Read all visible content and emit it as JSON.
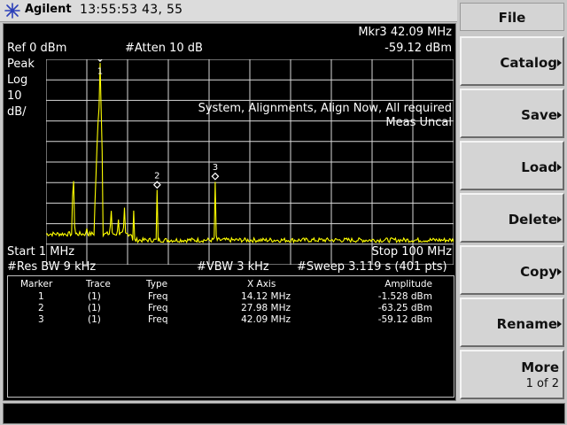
{
  "brand": "Agilent",
  "status_clock": "13:55:53   43,  55",
  "colors": {
    "trace": "#ffff00",
    "screen_bg": "#000000",
    "graticule": "#d8d8d8"
  },
  "header": {
    "ref_level": "Ref 0 dBm",
    "atten": "#Atten 10 dB",
    "marker_freq": "Mkr3  42.09 MHz",
    "marker_amp": "-59.12 dBm",
    "detector": "Peak",
    "scale_type": "Log",
    "scale_value": "10",
    "scale_unit": "dB/"
  },
  "messages": {
    "alignment": "System, Alignments, Align Now, All required",
    "meas_uncal": "Meas Uncal"
  },
  "footer": {
    "start": "Start 1 MHz",
    "stop": "Stop 100 MHz",
    "res_bw": "#Res BW 9 kHz",
    "vbw": "#VBW 3 kHz",
    "sweep": "#Sweep 3.119 s (401 pts)"
  },
  "marker_labels": [
    "1",
    "2",
    "3"
  ],
  "markers": [
    {
      "freq_mhz": 14.12,
      "amp_dbm": -1.528
    },
    {
      "freq_mhz": 27.98,
      "amp_dbm": -63.25
    },
    {
      "freq_mhz": 42.09,
      "amp_dbm": -59.12
    }
  ],
  "marker_table": {
    "headers": [
      "Marker",
      "Trace",
      "Type",
      "X Axis",
      "Amplitude"
    ],
    "rows": [
      [
        "1",
        "(1)",
        "Freq",
        "14.12 MHz",
        "-1.528 dBm"
      ],
      [
        "2",
        "(1)",
        "Freq",
        "27.98 MHz",
        "-63.25 dBm"
      ],
      [
        "3",
        "(1)",
        "Freq",
        "42.09 MHz",
        "-59.12 dBm"
      ]
    ]
  },
  "softkeys": {
    "title": "File",
    "catalog": "Catalog",
    "save": "Save",
    "load": "Load",
    "delete": "Delete",
    "copy": "Copy",
    "rename": "Rename",
    "more": "More",
    "more_page": "1 of 2"
  }
}
